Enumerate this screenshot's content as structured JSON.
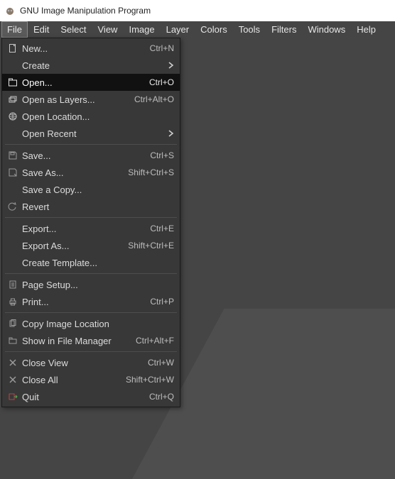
{
  "window": {
    "title": "GNU Image Manipulation Program"
  },
  "menubar": {
    "items": [
      "File",
      "Edit",
      "Select",
      "View",
      "Image",
      "Layer",
      "Colors",
      "Tools",
      "Filters",
      "Windows",
      "Help"
    ],
    "active_index": 0
  },
  "file_menu": {
    "new": {
      "label": "New...",
      "accel": "Ctrl+N",
      "icon": "new"
    },
    "create": {
      "label": "Create",
      "submenu": true
    },
    "open": {
      "label": "Open...",
      "accel": "Ctrl+O",
      "icon": "open"
    },
    "open_as_layers": {
      "label": "Open as Layers...",
      "accel": "Ctrl+Alt+O",
      "icon": "layers"
    },
    "open_location": {
      "label": "Open Location...",
      "icon": "globe"
    },
    "open_recent": {
      "label": "Open Recent",
      "submenu": true
    },
    "save": {
      "label": "Save...",
      "accel": "Ctrl+S",
      "icon": "save"
    },
    "save_as": {
      "label": "Save As...",
      "accel": "Shift+Ctrl+S",
      "icon": "save-as"
    },
    "save_copy": {
      "label": "Save a Copy..."
    },
    "revert": {
      "label": "Revert",
      "icon": "revert"
    },
    "export": {
      "label": "Export...",
      "accel": "Ctrl+E"
    },
    "export_as": {
      "label": "Export As...",
      "accel": "Shift+Ctrl+E"
    },
    "create_template": {
      "label": "Create Template..."
    },
    "page_setup": {
      "label": "Page Setup...",
      "icon": "page"
    },
    "print": {
      "label": "Print...",
      "accel": "Ctrl+P",
      "icon": "print"
    },
    "copy_loc": {
      "label": "Copy Image Location",
      "icon": "copy"
    },
    "show_fm": {
      "label": "Show in File Manager",
      "accel": "Ctrl+Alt+F",
      "icon": "folder"
    },
    "close_view": {
      "label": "Close View",
      "accel": "Ctrl+W",
      "icon": "close"
    },
    "close_all": {
      "label": "Close All",
      "accel": "Shift+Ctrl+W",
      "icon": "close"
    },
    "quit": {
      "label": "Quit",
      "accel": "Ctrl+Q",
      "icon": "quit"
    }
  }
}
